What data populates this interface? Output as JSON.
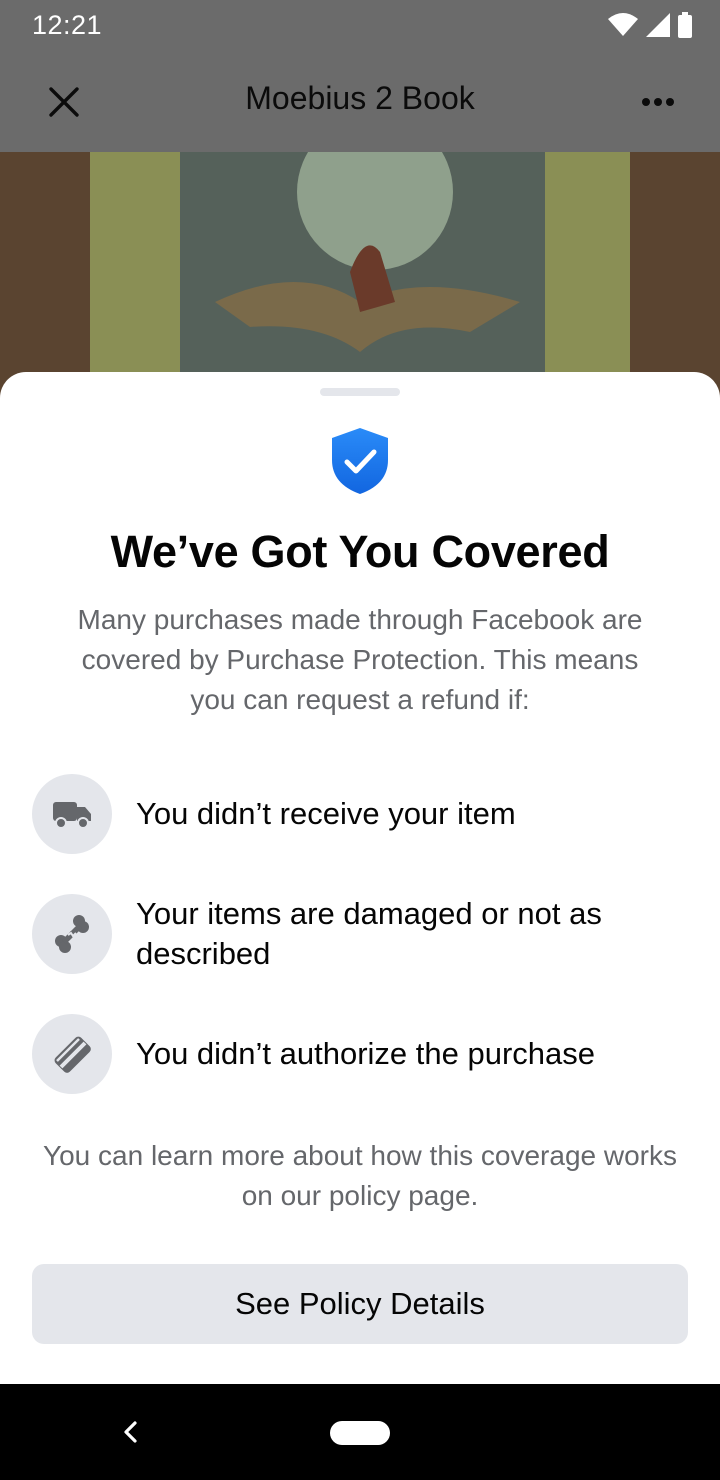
{
  "status_bar": {
    "time": "12:21",
    "icons": [
      "wifi-icon",
      "cellular-signal-icon",
      "battery-icon"
    ]
  },
  "header": {
    "title": "Moebius 2 Book",
    "close_icon": "close-icon",
    "more_icon": "more-options-icon"
  },
  "sheet": {
    "icon": "shield-check-icon",
    "title": "We’ve Got You Covered",
    "intro": "Many purchases made through Facebook are covered by Purchase Protection. This means you can request a refund if:",
    "reasons": [
      {
        "icon": "truck-icon",
        "label": "You didn’t receive your item"
      },
      {
        "icon": "broken-bone-icon",
        "label": "Your items are damaged or not as described"
      },
      {
        "icon": "credit-card-slash-icon",
        "label": "You didn’t authorize the purchase"
      }
    ],
    "footnote": "You can learn more about how this coverage works on our policy page.",
    "button_label": "See Policy Details"
  },
  "colors": {
    "accent_blue": "#1877f2",
    "secondary_text": "#65676b",
    "button_bg": "#e4e6eb",
    "dim_overlay": "#6b6b6b"
  }
}
